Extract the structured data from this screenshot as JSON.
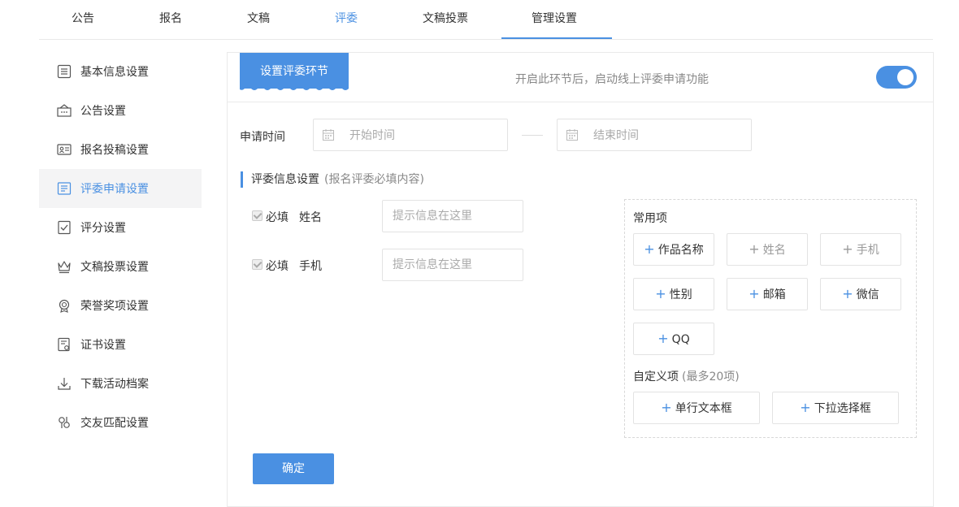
{
  "top_tabs": [
    {
      "label": "公告"
    },
    {
      "label": "报名"
    },
    {
      "label": "文稿"
    },
    {
      "label": "评委"
    },
    {
      "label": "文稿投票"
    },
    {
      "label": "管理设置"
    }
  ],
  "sidebar": {
    "items": [
      {
        "label": "基本信息设置",
        "icon": "info-list-icon"
      },
      {
        "label": "公告设置",
        "icon": "announcement-icon"
      },
      {
        "label": "报名投稿设置",
        "icon": "id-card-icon"
      },
      {
        "label": "评委申请设置",
        "icon": "judge-form-icon"
      },
      {
        "label": "评分设置",
        "icon": "checklist-icon"
      },
      {
        "label": "文稿投票设置",
        "icon": "crown-icon"
      },
      {
        "label": "荣誉奖项设置",
        "icon": "trophy-icon"
      },
      {
        "label": "证书设置",
        "icon": "certificate-icon"
      },
      {
        "label": "下载活动档案",
        "icon": "download-icon"
      },
      {
        "label": "交友匹配设置",
        "icon": "match-icon"
      }
    ],
    "active_index": 3
  },
  "header": {
    "ribbon_label": "设置评委环节",
    "hint": "开启此环节后，启动线上评委申请功能",
    "toggle_on": true
  },
  "apply_time": {
    "label": "申请时间",
    "start_placeholder": "开始时间",
    "end_placeholder": "结束时间"
  },
  "judge_info": {
    "title": "评委信息设置",
    "subtitle": "(报名评委必填内容)",
    "fields": [
      {
        "required_label": "必填",
        "name": "姓名",
        "placeholder": "提示信息在这里"
      },
      {
        "required_label": "必填",
        "name": "手机",
        "placeholder": "提示信息在这里"
      }
    ]
  },
  "common_items": {
    "title": "常用项",
    "options": [
      {
        "label": "作品名称",
        "enabled": true
      },
      {
        "label": "姓名",
        "enabled": false
      },
      {
        "label": "手机",
        "enabled": false
      },
      {
        "label": "性别",
        "enabled": true
      },
      {
        "label": "邮箱",
        "enabled": true
      },
      {
        "label": "微信",
        "enabled": true
      },
      {
        "label": "QQ",
        "enabled": true
      }
    ]
  },
  "custom_items": {
    "title": "自定义项",
    "subtitle": "(最多20项)",
    "options": [
      {
        "label": "单行文本框"
      },
      {
        "label": "下拉选择框"
      }
    ]
  },
  "confirm_label": "确定",
  "colors": {
    "accent": "#4a90e2",
    "border": "#e3e3e3",
    "muted": "#888888"
  }
}
